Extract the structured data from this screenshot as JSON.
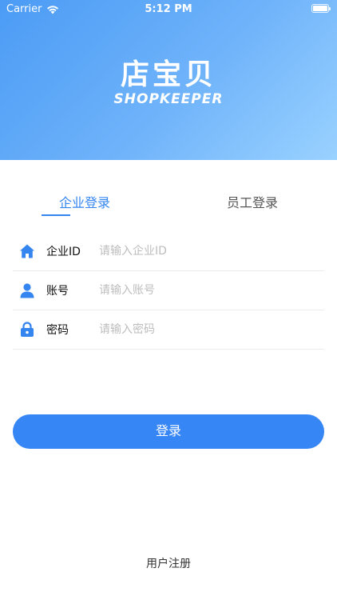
{
  "status_bar": {
    "carrier": "Carrier",
    "time": "5:12 PM",
    "wifi_icon": "wifi-icon",
    "battery_icon": "battery-icon"
  },
  "logo": {
    "title_cn": "店宝贝",
    "title_en": "SHOPKEEPER"
  },
  "tabs": [
    {
      "label": "企业登录",
      "active": true
    },
    {
      "label": "员工登录",
      "active": false
    }
  ],
  "form": {
    "fields": [
      {
        "icon": "home-icon",
        "label": "企业ID",
        "placeholder": "请输入企业ID",
        "value": ""
      },
      {
        "icon": "user-icon",
        "label": "账号",
        "placeholder": "请输入账号",
        "value": ""
      },
      {
        "icon": "lock-icon",
        "label": "密码",
        "placeholder": "请输入密码",
        "value": ""
      }
    ]
  },
  "login_button": {
    "label": "登录"
  },
  "register": {
    "label": "用户注册"
  },
  "colors": {
    "accent": "#3585f0",
    "header_gradient_start": "#4b9bf5",
    "header_gradient_end": "#9ad2ff"
  }
}
